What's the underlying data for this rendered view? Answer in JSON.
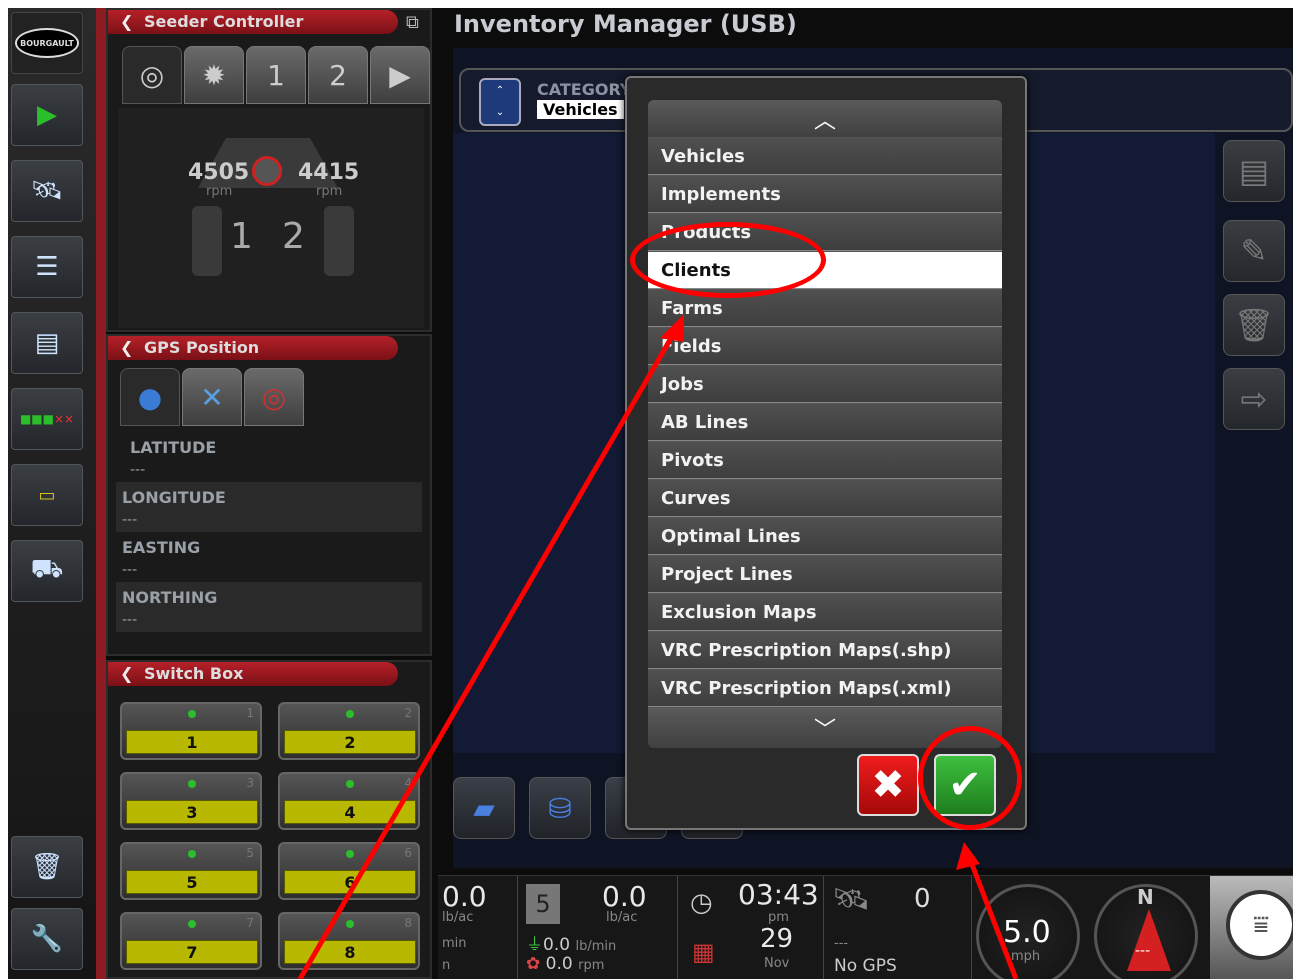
{
  "seeder_panel": {
    "title": "Seeder Controller",
    "tabs": [
      "1",
      "2"
    ],
    "left_rpm": "4505",
    "right_rpm": "4415",
    "rpm_unit": "rpm",
    "section_labels": [
      "1",
      "2"
    ]
  },
  "gps_panel": {
    "title": "GPS Position",
    "rows": [
      {
        "label": "LATITUDE",
        "value": "---"
      },
      {
        "label": "LONGITUDE",
        "value": "---"
      },
      {
        "label": "EASTING",
        "value": "---"
      },
      {
        "label": "NORTHING",
        "value": "---"
      }
    ]
  },
  "switch_panel": {
    "title": "Switch Box",
    "switches": [
      {
        "num": "1",
        "label": "1"
      },
      {
        "num": "2",
        "label": "2"
      },
      {
        "num": "3",
        "label": "3"
      },
      {
        "num": "4",
        "label": "4"
      },
      {
        "num": "5",
        "label": "5"
      },
      {
        "num": "6",
        "label": "6"
      },
      {
        "num": "7",
        "label": "7"
      },
      {
        "num": "8",
        "label": "8"
      }
    ]
  },
  "main": {
    "title": "Inventory Manager (USB)",
    "category_label": "CATEGORY",
    "category_value": "Vehicles"
  },
  "dropdown": {
    "items": [
      "Vehicles",
      "Implements",
      "Products",
      "Clients",
      "Farms",
      "Fields",
      "Jobs",
      "AB Lines",
      "Pivots",
      "Curves",
      "Optimal Lines",
      "Project Lines",
      "Exclusion Maps",
      "VRC Prescription Maps(.shp)",
      "VRC Prescription Maps(.xml)"
    ],
    "selected": "Clients",
    "cancel_glyph": "✖",
    "ok_glyph": "✔"
  },
  "status_bar": {
    "left_rate": "0.0",
    "left_rate_unit": "lb/ac",
    "left_sub": "min",
    "left_sub2": "n",
    "section_count": "5",
    "rate": "0.0",
    "rate_unit": "lb/ac",
    "flow": "0.0",
    "flow_unit": "lb/min",
    "fan": "0.0",
    "fan_unit": "rpm",
    "time": "03:43",
    "ampm": "pm",
    "day": "29",
    "month": "Nov",
    "satellites": "0",
    "gps_sub": "---",
    "gps_status": "No GPS",
    "speed": "5.0",
    "speed_unit": "mph",
    "compass": "N",
    "compass_sub": "---"
  },
  "colors": {
    "annotation": "#ff0000",
    "switch_yellow": "#b8b800",
    "ok_green": "#2aa52a",
    "cancel_red": "#d81212"
  }
}
